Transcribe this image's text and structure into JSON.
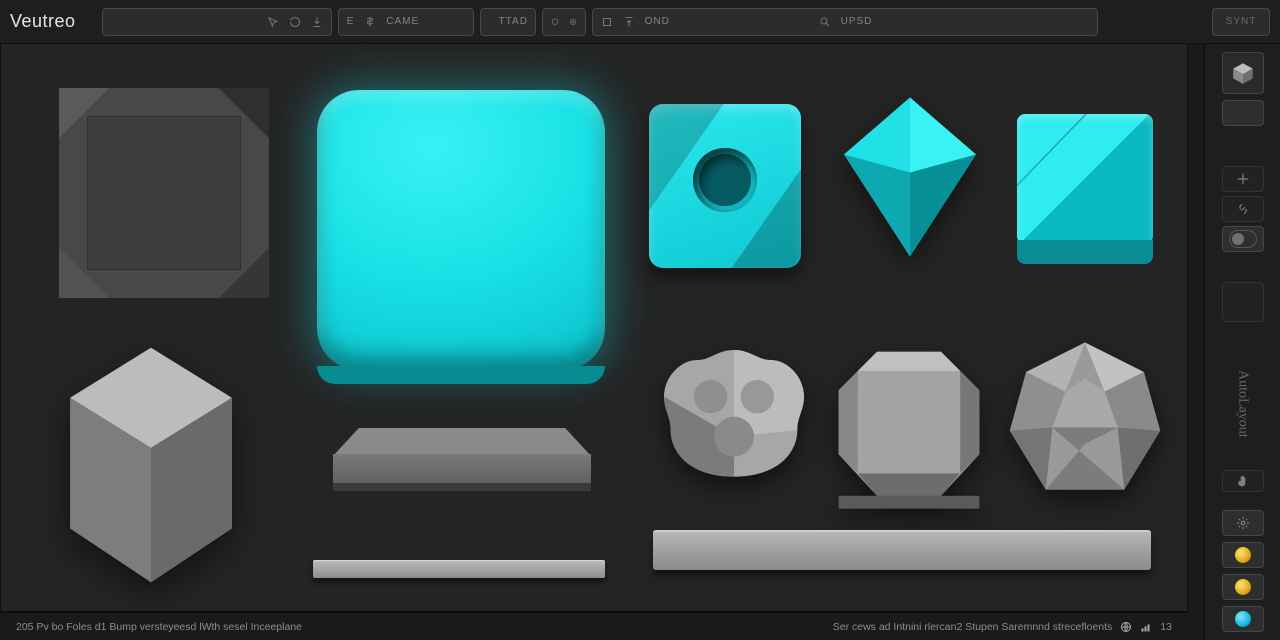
{
  "app": {
    "name": "Veutreo"
  },
  "toolbar": {
    "box2_prefix": "E",
    "box2_label": "CAME",
    "box3_label": "TTAD",
    "box5_label": "OND",
    "box5b_label": "UPSD",
    "box6_label": "SYNT"
  },
  "rightbar": {
    "vertical_label": "AutoLayout"
  },
  "status": {
    "left": "205 Pv bo Foles d1 Bump versteyeesd lWth sesel Inceeplane",
    "right": "Ser cews ad Intnini rlercan2 Stupen  Saremnnd strecefloents",
    "percent": "13"
  },
  "icons": {
    "cursor": "cursor",
    "refresh": "refresh",
    "download": "download",
    "tag": "tag",
    "shield": "shield",
    "target": "target",
    "box": "box",
    "upload": "upload",
    "search": "search",
    "gear": "gear",
    "globe": "globe",
    "hand": "hand"
  }
}
